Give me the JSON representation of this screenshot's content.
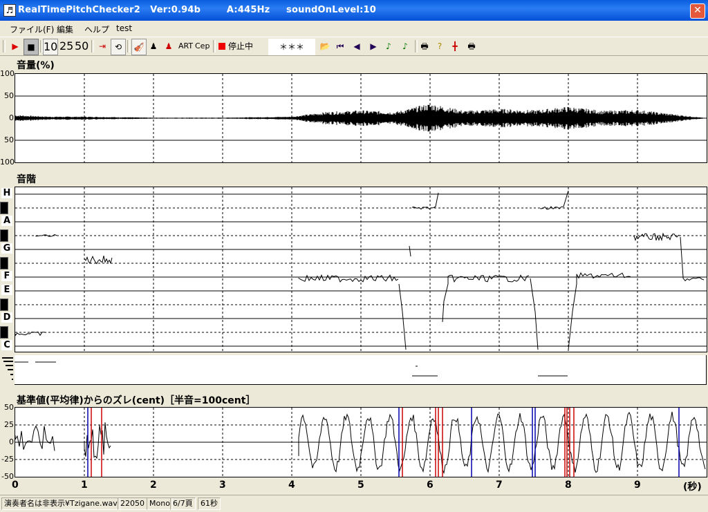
{
  "window": {
    "title": "RealTimePitchChecker2   Ver:0.94b        A:445Hz     soundOnLevel:10",
    "icon": "music-note-icon"
  },
  "menu": [
    "ファイル(F)",
    "編集",
    "ヘルプ",
    "test"
  ],
  "toolbar": {
    "speeds": [
      "10",
      "25",
      "50"
    ],
    "art": "ART",
    "cep": "Cep",
    "status": "停止中",
    "display": "＊＊＊"
  },
  "volume_panel": {
    "label": "音量(%)",
    "ticks": [
      "100",
      "50",
      "0",
      "50",
      "100"
    ]
  },
  "scale_panel": {
    "label": "音階",
    "notes": [
      "H",
      "A",
      "G",
      "F",
      "E",
      "D",
      "C"
    ]
  },
  "cent_panel": {
    "label": "基準値(平均律)からのズレ(cent)［半音=100cent］",
    "ticks": [
      "50",
      "25",
      "0",
      "-25",
      "-50"
    ]
  },
  "x_axis": {
    "ticks": [
      "0",
      "1",
      "2",
      "3",
      "4",
      "5",
      "6",
      "7",
      "8",
      "9"
    ],
    "unit": "(秒)"
  },
  "status_bar": [
    "演奏者名は非表示¥Tzigane.wav",
    "22050",
    "Mono",
    "6/7頁",
    "61秒"
  ],
  "colors": {
    "title": "#0a5ee0",
    "accent_red": "#cc0000",
    "accent_blue": "#0000aa"
  },
  "chart_data": [
    {
      "type": "area",
      "label": "音量(%)",
      "ylim": [
        -100,
        100
      ],
      "xlim": [
        0,
        10
      ],
      "x": [
        0,
        0.5,
        1,
        2,
        3,
        4,
        4.5,
        5,
        5.5,
        6,
        6.5,
        7,
        7.5,
        8,
        8.5,
        9,
        9.5,
        10
      ],
      "envelope": [
        6,
        3,
        3,
        1,
        1,
        3,
        12,
        15,
        12,
        28,
        14,
        18,
        15,
        22,
        14,
        16,
        8,
        0
      ]
    },
    {
      "type": "line",
      "label": "音階",
      "ylim": [
        "C",
        "H"
      ],
      "xlim": [
        0,
        10
      ]
    },
    {
      "type": "line",
      "label": "基準値(平均律)からのズレ(cent)",
      "ylim": [
        -50,
        50
      ],
      "xlim": [
        0,
        10
      ]
    }
  ]
}
